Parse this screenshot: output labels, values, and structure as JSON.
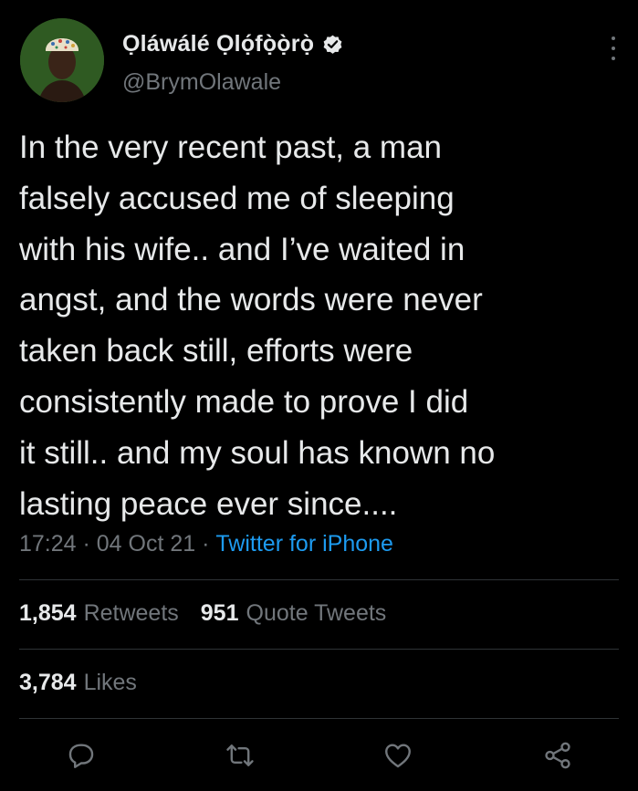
{
  "tweet": {
    "author": {
      "display_name": "Ọláwálé Ọlọ́fọ̀ọ̀rọ̀",
      "handle": "@BrymOlawale",
      "verified": true
    },
    "text": "In the very recent past, a man\nfalsely accused me of sleeping\nwith his wife.. and I’ve waited in\nangst, and the words were never\ntaken back still, efforts were\nconsistently made to prove I did\nit still.. and my soul has known no\nlasting peace ever since....",
    "time": "17:24",
    "date": "04 Oct 21",
    "separator": " · ",
    "source": "Twitter for iPhone",
    "stats": {
      "retweets_count": "1,854",
      "retweets_label": "Retweets",
      "quotes_count": "951",
      "quotes_label": "Quote Tweets",
      "likes_count": "3,784",
      "likes_label": "Likes"
    },
    "actions": [
      {
        "icon": "reply-icon"
      },
      {
        "icon": "retweet-icon"
      },
      {
        "icon": "like-icon"
      },
      {
        "icon": "share-icon"
      }
    ]
  },
  "colors": {
    "background": "#000000",
    "text_primary": "#e7e9ea",
    "text_secondary": "#71767b",
    "accent": "#1d9bf0",
    "divider": "#2f3336"
  }
}
